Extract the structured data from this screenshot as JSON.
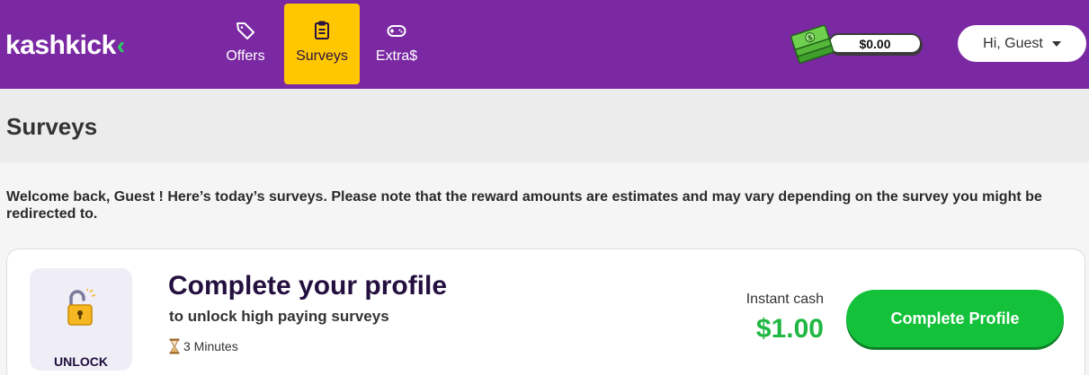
{
  "brand": {
    "name": "kashkick",
    "mark": "‹"
  },
  "nav": {
    "items": [
      {
        "label": "Offers",
        "icon": "tag-icon",
        "active": false
      },
      {
        "label": "Surveys",
        "icon": "clipboard-icon",
        "active": true
      },
      {
        "label": "Extra$",
        "icon": "gamepad-icon",
        "active": false
      }
    ]
  },
  "wallet": {
    "balance": "$0.00",
    "icon": "cash-stack-icon"
  },
  "user": {
    "greeting": "Hi, Guest"
  },
  "page": {
    "title": "Surveys",
    "welcome": "Welcome back, Guest ! Here’s today’s surveys. Please note that the reward amounts are estimates and may vary depending on the survey you might be redirected to."
  },
  "card": {
    "badge_label": "UNLOCK",
    "title": "Complete your profile",
    "subtitle": "to unlock high paying surveys",
    "duration": "3 Minutes",
    "cash_label": "Instant cash",
    "cash_amount": "$1.00",
    "cta_label": "Complete Profile"
  },
  "colors": {
    "header_bg": "#7a29a3",
    "active_tab": "#ffc700",
    "accent_green": "#13c13a",
    "amount_green": "#20b843",
    "title_dark": "#24103f"
  }
}
